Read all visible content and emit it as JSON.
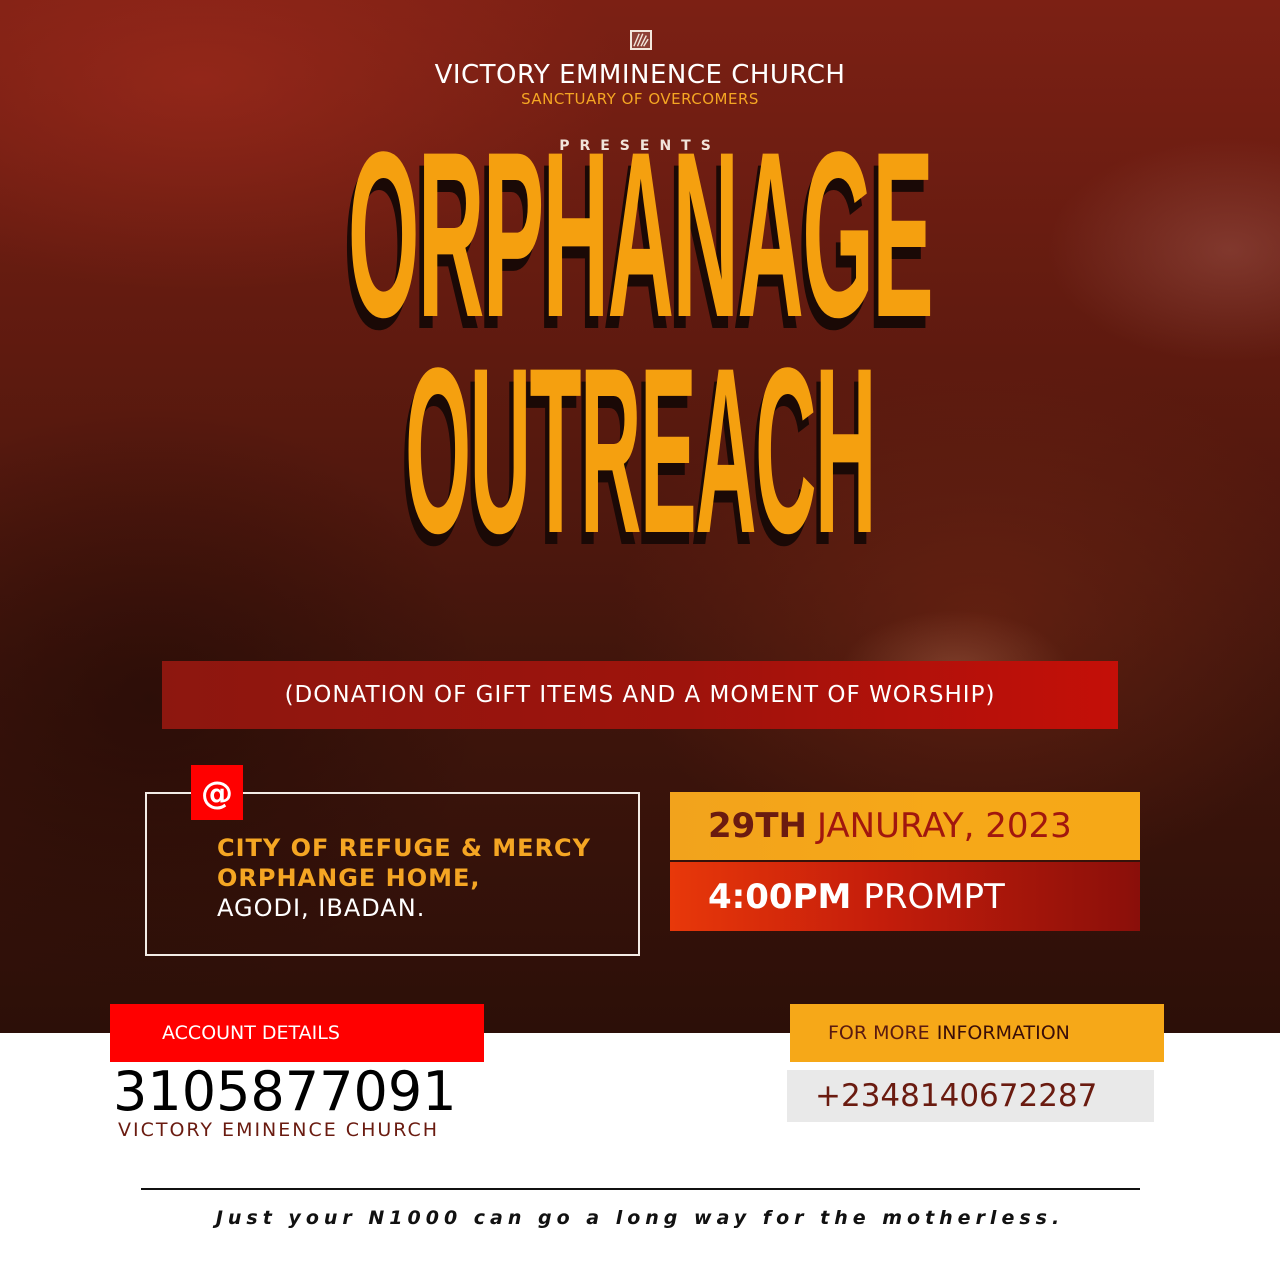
{
  "header": {
    "logo_icon": "church-logo-icon",
    "church_name": "VICTORY EMMINENCE CHURCH",
    "tagline": "SANCTUARY OF OVERCOMERS",
    "presents": "PRESENTS"
  },
  "title": {
    "line1": "ORPHANAGE",
    "line2": "OUTREACH"
  },
  "subtitle": "(DONATION OF GIFT ITEMS AND A MOMENT OF WORSHIP)",
  "venue": {
    "at_symbol": "@",
    "line1": "CITY OF REFUGE & MERCY",
    "line2": "ORPHANGE HOME,",
    "line3": "AGODI, IBADAN."
  },
  "schedule": {
    "date_day": "29TH",
    "date_rest": "JANURAY, 2023",
    "time": "4:00PM",
    "time_note": "PROMPT"
  },
  "account": {
    "label": "ACCOUNT DETAILS",
    "number": "3105877091",
    "name": "VICTORY EMINENCE CHURCH"
  },
  "contact": {
    "label_part1": "FOR MORE",
    "label_part2": "INFORMATION",
    "phone": "+2348140672287"
  },
  "footer": {
    "text": "Just your N1000 can go a long way for the motherless."
  },
  "colors": {
    "accent_orange": "#f5a00f",
    "accent_red": "#ff0000",
    "dark_maroon": "#6a1b10",
    "background_dark_red": "#5e1a0f"
  }
}
